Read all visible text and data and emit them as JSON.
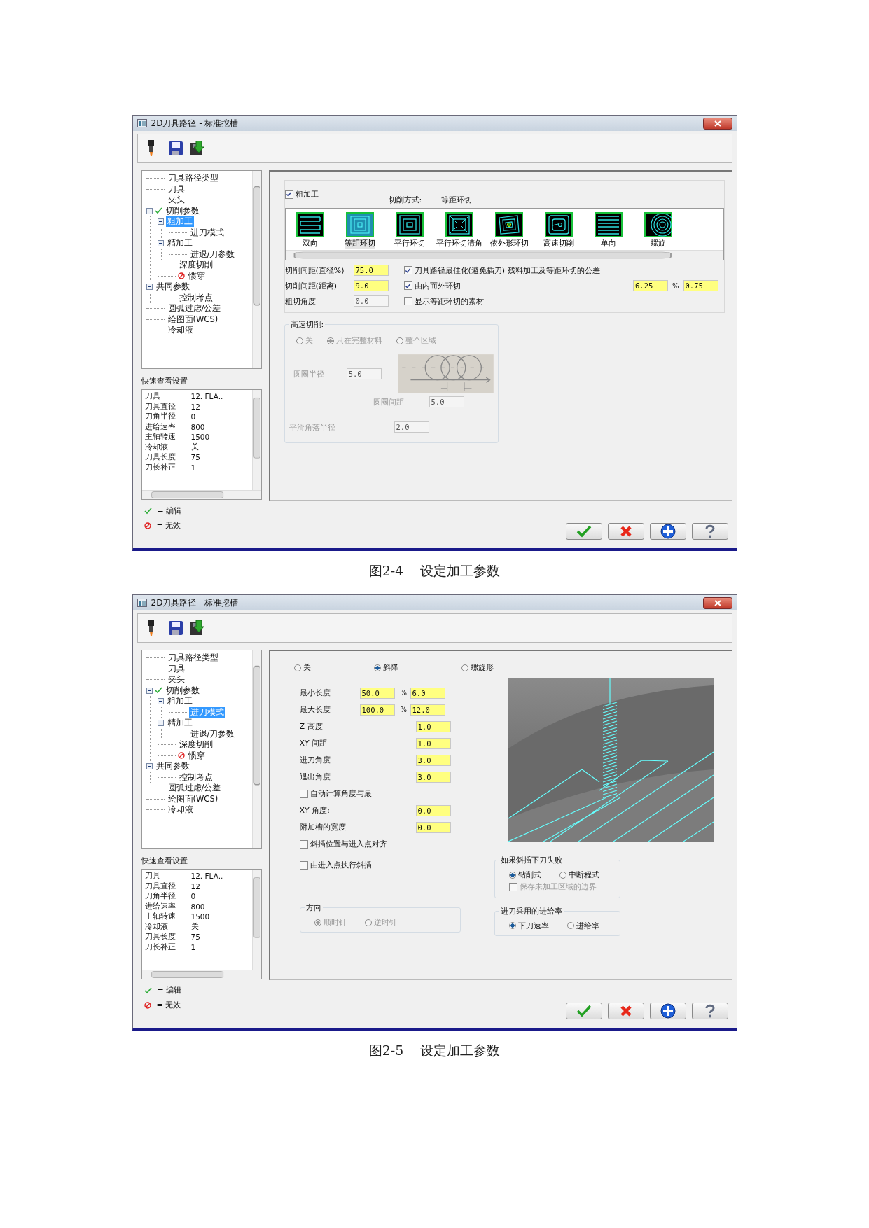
{
  "dialogs": [
    {
      "title": "2D刀具路径 - 标准挖槽",
      "sidebar": {
        "tree": [
          {
            "label": "刀具路径类型",
            "selected": false
          },
          {
            "label": "刀具",
            "selected": false
          },
          {
            "label": "夹头",
            "selected": false
          },
          {
            "label": "切削参数",
            "selected": false,
            "kind": "check",
            "expanded": true,
            "children": [
              {
                "label": "粗加工",
                "selected": true,
                "expanded": true,
                "children": [
                  {
                    "label": "进刀模式",
                    "selected": false
                  }
                ]
              },
              {
                "label": "精加工",
                "selected": false,
                "expanded": true,
                "children": [
                  {
                    "label": "进退/刀参数",
                    "selected": false
                  }
                ]
              },
              {
                "label": "深度切削",
                "selected": false
              },
              {
                "label": "惯穿",
                "selected": false,
                "kind": "invalid"
              }
            ]
          },
          {
            "label": "共同参数",
            "selected": false,
            "expanded": true,
            "children": [
              {
                "label": "控制考点",
                "selected": false
              }
            ]
          },
          {
            "label": "圆弧过虑/公差",
            "selected": false
          },
          {
            "label": "绘图面(WCS)",
            "selected": false
          },
          {
            "label": "冷却液",
            "selected": false
          }
        ],
        "quick_view_title": "快速查看设置",
        "quick_view": [
          {
            "label": "刀具",
            "value": "12. FLA.."
          },
          {
            "label": "刀具直径",
            "value": "12"
          },
          {
            "label": "刀角半径",
            "value": "0"
          },
          {
            "label": "进给速率",
            "value": "800"
          },
          {
            "label": "主轴转速",
            "value": "1500"
          },
          {
            "label": "冷却液",
            "value": "关"
          },
          {
            "label": "刀具长度",
            "value": "75"
          },
          {
            "label": "刀长补正",
            "value": "1"
          }
        ],
        "legend": [
          {
            "kind": "check",
            "label": "= 编辑"
          },
          {
            "kind": "invalid",
            "label": "= 无效"
          }
        ]
      },
      "panel": {
        "kind": "roughing",
        "enabled_check": {
          "label": "粗加工",
          "checked": true
        },
        "method_label": "切削方式:",
        "method_value": "等距环切",
        "patterns": [
          {
            "kind": "zigzag",
            "label": "双向",
            "selected": false
          },
          {
            "kind": "constant-overlap",
            "label": "等距环切",
            "selected": true
          },
          {
            "kind": "parallel-spiral",
            "label": "平行环切",
            "selected": false
          },
          {
            "kind": "parallel-clean",
            "label": "平行环切清角",
            "selected": false
          },
          {
            "kind": "morph-spiral",
            "label": "依外形环切",
            "selected": false
          },
          {
            "kind": "high-speed",
            "label": "高速切削",
            "selected": false
          },
          {
            "kind": "one-way",
            "label": "单向",
            "selected": false
          },
          {
            "kind": "true-spiral",
            "label": "螺旋",
            "selected": false
          }
        ],
        "fields": [
          {
            "label": "切削间距(直径%)",
            "value": "75.0",
            "disabled": false
          },
          {
            "label": "切削间距(距离)",
            "value": "9.0",
            "disabled": false
          },
          {
            "label": "粗切角度",
            "value": "0.0",
            "disabled": true
          }
        ],
        "options": [
          {
            "label": "刀具路径最佳化(避免插刀)",
            "checked": true
          },
          {
            "label": "由内而外环切",
            "checked": true
          },
          {
            "label": "显示等距环切的素材",
            "checked": false
          }
        ],
        "tolerance": {
          "label": "残料加工及等距环切的公差",
          "percent": "6.25",
          "unit": "%",
          "value": "0.75"
        },
        "high_speed": {
          "title": "高速切削:",
          "disabled": true,
          "modes": [
            {
              "label": "关",
              "selected": false
            },
            {
              "label": "只在完整材料",
              "selected": true
            },
            {
              "label": "整个区域",
              "selected": false
            }
          ],
          "loop_radius": {
            "label": "圆圈半径",
            "value": "5.0"
          },
          "loop_spacing": {
            "label": "圆圈间距",
            "value": "5.0"
          },
          "corner_radius": {
            "label": "平滑角落半径",
            "value": "2.0"
          }
        }
      },
      "buttons": [
        {
          "kind": "ok"
        },
        {
          "kind": "cancel"
        },
        {
          "kind": "add"
        },
        {
          "kind": "help"
        }
      ],
      "caption": {
        "number": "图2-4",
        "title": "设定加工参数"
      }
    },
    {
      "title": "2D刀具路径 - 标准挖槽",
      "sidebar": {
        "tree": [
          {
            "label": "刀具路径类型",
            "selected": false
          },
          {
            "label": "刀具",
            "selected": false
          },
          {
            "label": "夹头",
            "selected": false
          },
          {
            "label": "切削参数",
            "selected": false,
            "kind": "check",
            "expanded": true,
            "children": [
              {
                "label": "粗加工",
                "selected": false,
                "expanded": true,
                "children": [
                  {
                    "label": "进刀模式",
                    "selected": true
                  }
                ]
              },
              {
                "label": "精加工",
                "selected": false,
                "expanded": true,
                "children": [
                  {
                    "label": "进退/刀参数",
                    "selected": false
                  }
                ]
              },
              {
                "label": "深度切削",
                "selected": false
              },
              {
                "label": "惯穿",
                "selected": false,
                "kind": "invalid"
              }
            ]
          },
          {
            "label": "共同参数",
            "selected": false,
            "expanded": true,
            "children": [
              {
                "label": "控制考点",
                "selected": false
              }
            ]
          },
          {
            "label": "圆弧过虑/公差",
            "selected": false
          },
          {
            "label": "绘图面(WCS)",
            "selected": false
          },
          {
            "label": "冷却液",
            "selected": false
          }
        ],
        "quick_view_title": "快速查看设置",
        "quick_view": [
          {
            "label": "刀具",
            "value": "12. FLA.."
          },
          {
            "label": "刀具直径",
            "value": "12"
          },
          {
            "label": "刀角半径",
            "value": "0"
          },
          {
            "label": "进给速率",
            "value": "800"
          },
          {
            "label": "主轴转速",
            "value": "1500"
          },
          {
            "label": "冷却液",
            "value": "关"
          },
          {
            "label": "刀具长度",
            "value": "75"
          },
          {
            "label": "刀长补正",
            "value": "1"
          }
        ],
        "legend": [
          {
            "kind": "check",
            "label": "= 编辑"
          },
          {
            "kind": "invalid",
            "label": "= 无效"
          }
        ]
      },
      "panel": {
        "kind": "entry",
        "modes": [
          {
            "label": "关",
            "selected": false
          },
          {
            "label": "斜降",
            "selected": true
          },
          {
            "label": "螺旋形",
            "selected": false
          }
        ],
        "rows": [
          {
            "kind": "range",
            "label": "最小长度",
            "percent": "50.0",
            "unit": "%",
            "value": "6.0"
          },
          {
            "kind": "range",
            "label": "最大长度",
            "percent": "100.0",
            "unit": "%",
            "value": "12.0"
          },
          {
            "kind": "field",
            "label": "Z 高度",
            "value": "1.0"
          },
          {
            "kind": "field",
            "label": "XY 间距",
            "value": "1.0"
          },
          {
            "kind": "field",
            "label": "进刀角度",
            "value": "3.0"
          },
          {
            "kind": "field",
            "label": "退出角度",
            "value": "3.0"
          },
          {
            "kind": "check",
            "label": "自动计算角度与最",
            "checked": false
          },
          {
            "kind": "field",
            "label": "XY 角度:",
            "value": "0.0"
          },
          {
            "kind": "field",
            "label": "附加槽的宽度",
            "value": "0.0"
          },
          {
            "kind": "check",
            "label": "斜插位置与进入点对齐",
            "checked": false
          }
        ],
        "plunge_check": {
          "label": "由进入点执行斜插",
          "checked": false
        },
        "direction": {
          "title": "方向",
          "disabled": true,
          "options": [
            {
              "label": "顺时针",
              "selected": true
            },
            {
              "label": "逆时针",
              "selected": false
            }
          ]
        },
        "fail_group": {
          "title": "如果斜插下刀失败",
          "options": [
            {
              "label": "钻削式",
              "selected": true
            },
            {
              "label": "中断程式",
              "selected": false
            }
          ],
          "save_boundary": {
            "label": "保存未加工区域的边界",
            "checked": false,
            "disabled": true
          }
        },
        "feed": {
          "title": "进刀采用的进给率",
          "options": [
            {
              "label": "下刀速率",
              "selected": true
            },
            {
              "label": "进给率",
              "selected": false
            }
          ]
        }
      },
      "buttons": [
        {
          "kind": "ok"
        },
        {
          "kind": "cancel"
        },
        {
          "kind": "add"
        },
        {
          "kind": "help"
        }
      ],
      "caption": {
        "number": "图2-5",
        "title": "设定加工参数"
      }
    }
  ]
}
